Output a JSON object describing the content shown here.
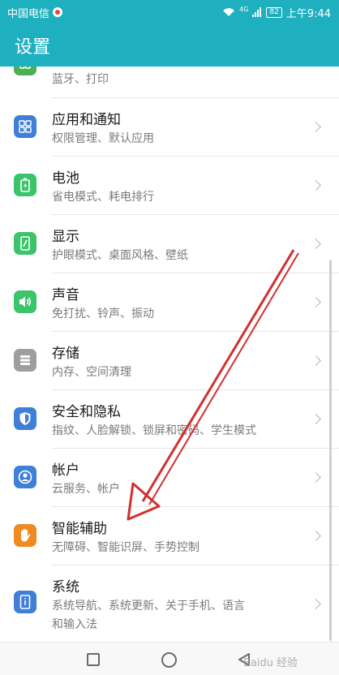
{
  "status_bar": {
    "carrier": "中国电信",
    "network_badge": "4G",
    "battery": "82",
    "time": "上午9:44"
  },
  "app_bar": {
    "title": "设置"
  },
  "settings": {
    "items": [
      {
        "title": "",
        "subtitle": "蓝牙、打印",
        "icon": "device-connection-icon",
        "color": "#4caf50"
      },
      {
        "title": "应用和通知",
        "subtitle": "权限管理、默认应用",
        "icon": "apps-grid-icon",
        "color": "#3f7fd8"
      },
      {
        "title": "电池",
        "subtitle": "省电模式、耗电排行",
        "icon": "battery-icon",
        "color": "#3cc46a"
      },
      {
        "title": "显示",
        "subtitle": "护眼模式、桌面风格、壁纸",
        "icon": "display-icon",
        "color": "#3cc46a"
      },
      {
        "title": "声音",
        "subtitle": "免打扰、铃声、振动",
        "icon": "speaker-icon",
        "color": "#3cc46a"
      },
      {
        "title": "存储",
        "subtitle": "内存、空间清理",
        "icon": "storage-icon",
        "color": "#9e9e9e"
      },
      {
        "title": "安全和隐私",
        "subtitle": "指纹、人脸解锁、锁屏和密码、学生模式",
        "icon": "shield-icon",
        "color": "#3f7fd8"
      },
      {
        "title": "帐户",
        "subtitle": "云服务、帐户",
        "icon": "account-icon",
        "color": "#3f7fd8"
      },
      {
        "title": "智能辅助",
        "subtitle": "无障碍、智能识屏、手势控制",
        "icon": "hand-icon",
        "color": "#f08a24"
      },
      {
        "title": "系统",
        "subtitle": "系统导航、系统更新、关于手机、语言",
        "subtitle2": "和输入法",
        "icon": "system-info-icon",
        "color": "#3f7fd8"
      }
    ]
  },
  "watermark": "Baidu 经验"
}
